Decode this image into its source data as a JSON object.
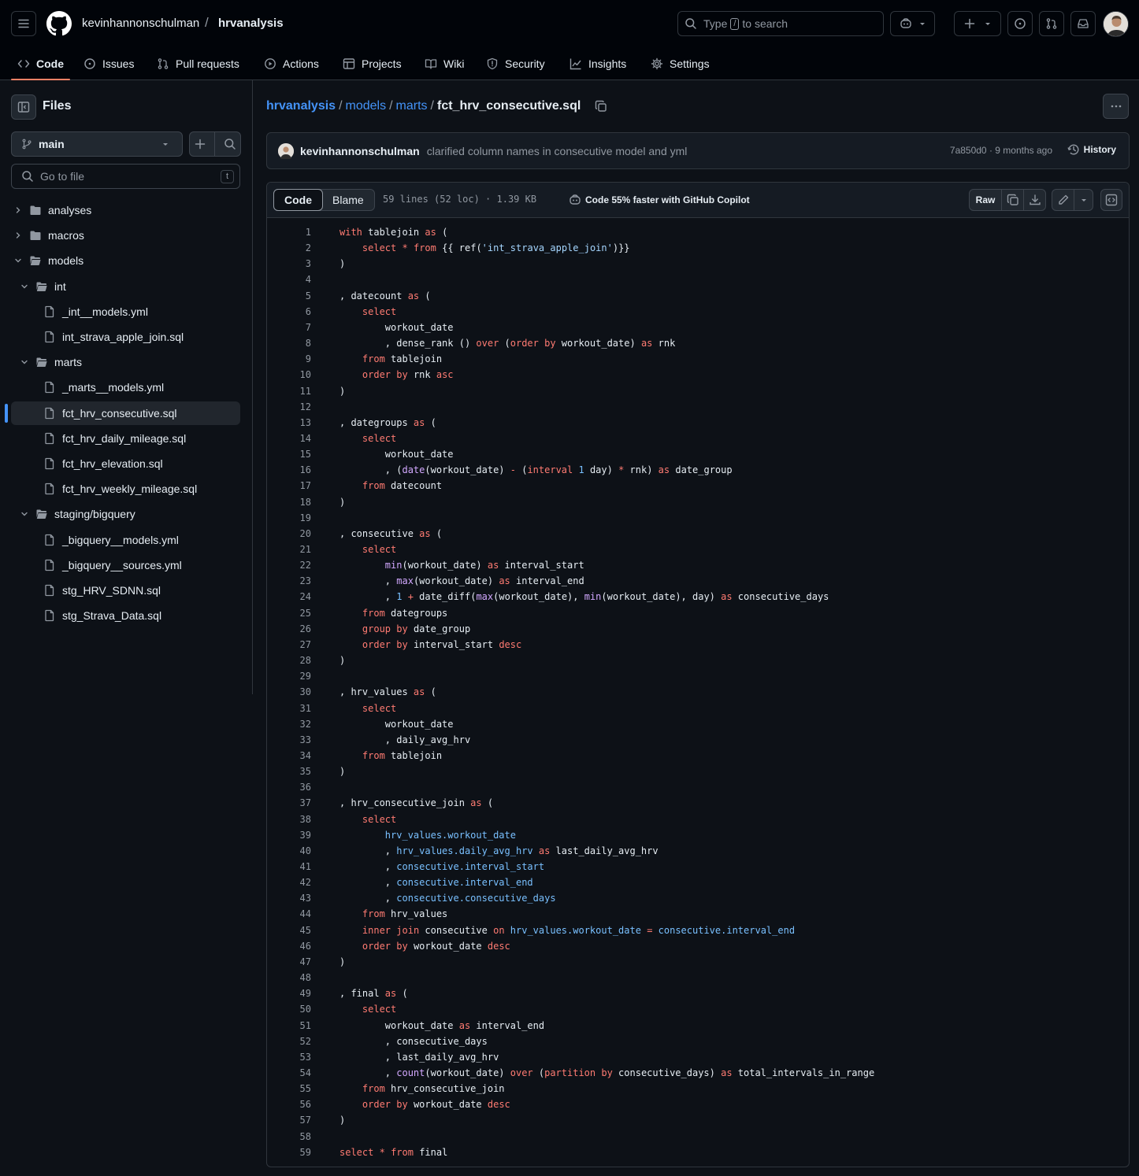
{
  "header": {
    "owner": "kevinhannonschulman",
    "separator": "/",
    "repo": "hrvanalysis",
    "search_pre": "Type",
    "search_key": "/",
    "search_post": "to search"
  },
  "repo_tabs": [
    {
      "label": "Code",
      "icon": "code-icon",
      "active": true
    },
    {
      "label": "Issues",
      "icon": "issue-icon"
    },
    {
      "label": "Pull requests",
      "icon": "pull-request-icon"
    },
    {
      "label": "Actions",
      "icon": "actions-play-icon"
    },
    {
      "label": "Projects",
      "icon": "table-icon"
    },
    {
      "label": "Wiki",
      "icon": "book-icon"
    },
    {
      "label": "Security",
      "icon": "shield-icon"
    },
    {
      "label": "Insights",
      "icon": "graph-icon"
    },
    {
      "label": "Settings",
      "icon": "gear-icon"
    }
  ],
  "sidebar": {
    "title": "Files",
    "branch": "main",
    "goto_placeholder": "Go to file",
    "goto_key": "t",
    "tree": [
      {
        "name": "analyses",
        "type": "folder",
        "depth": 0,
        "expanded": false
      },
      {
        "name": "macros",
        "type": "folder",
        "depth": 0,
        "expanded": false
      },
      {
        "name": "models",
        "type": "folder",
        "depth": 0,
        "expanded": true
      },
      {
        "name": "int",
        "type": "folder",
        "depth": 1,
        "expanded": true
      },
      {
        "name": "_int__models.yml",
        "type": "file",
        "depth": 2
      },
      {
        "name": "int_strava_apple_join.sql",
        "type": "file",
        "depth": 2
      },
      {
        "name": "marts",
        "type": "folder",
        "depth": 1,
        "expanded": true
      },
      {
        "name": "_marts__models.yml",
        "type": "file",
        "depth": 2
      },
      {
        "name": "fct_hrv_consecutive.sql",
        "type": "file",
        "depth": 2,
        "selected": true
      },
      {
        "name": "fct_hrv_daily_mileage.sql",
        "type": "file",
        "depth": 2
      },
      {
        "name": "fct_hrv_elevation.sql",
        "type": "file",
        "depth": 2
      },
      {
        "name": "fct_hrv_weekly_mileage.sql",
        "type": "file",
        "depth": 2
      },
      {
        "name": "staging/bigquery",
        "type": "folder",
        "depth": 1,
        "expanded": true
      },
      {
        "name": "_bigquery__models.yml",
        "type": "file",
        "depth": 2
      },
      {
        "name": "_bigquery__sources.yml",
        "type": "file",
        "depth": 2
      },
      {
        "name": "stg_HRV_SDNN.sql",
        "type": "file",
        "depth": 2
      },
      {
        "name": "stg_Strava_Data.sql",
        "type": "file",
        "depth": 2
      }
    ]
  },
  "breadcrumb": {
    "repo": "hrvanalysis",
    "path": [
      "models",
      "marts"
    ],
    "file": "fct_hrv_consecutive.sql"
  },
  "commit": {
    "author": "kevinhannonschulman",
    "message": "clarified column names in consecutive model and yml",
    "meta": "7a850d0 · 9 months ago",
    "history_label": "History"
  },
  "file_toolbar": {
    "code_tab": "Code",
    "blame_tab": "Blame",
    "file_meta": "59 lines (52 loc) · 1.39 KB",
    "copilot": "Code 55% faster with GitHub Copilot",
    "raw_label": "Raw"
  },
  "colors": {
    "accent": "#4493f8",
    "keyword": "#ff7b72",
    "function": "#d2a8ff",
    "string": "#a5d6ff",
    "tab_underline": "#f78166"
  },
  "code_lines": [
    "with tablejoin as (",
    "    select * from {{ ref('int_strava_apple_join')}}",
    ")",
    "",
    ", datecount as (",
    "    select",
    "        workout_date",
    "        , dense_rank () over (order by workout_date) as rnk",
    "    from tablejoin",
    "    order by rnk asc",
    ")",
    "",
    ", dategroups as (",
    "    select",
    "        workout_date",
    "        , (date(workout_date) - (interval 1 day) * rnk) as date_group",
    "    from datecount",
    ")",
    "",
    ", consecutive as (",
    "    select",
    "        min(workout_date) as interval_start",
    "        , max(workout_date) as interval_end",
    "        , 1 + date_diff(max(workout_date), min(workout_date), day) as consecutive_days",
    "    from dategroups",
    "    group by date_group",
    "    order by interval_start desc",
    ")",
    "",
    ", hrv_values as (",
    "    select",
    "        workout_date",
    "        , daily_avg_hrv",
    "    from tablejoin",
    ")",
    "",
    ", hrv_consecutive_join as (",
    "    select",
    "        hrv_values.workout_date",
    "        , hrv_values.daily_avg_hrv as last_daily_avg_hrv",
    "        , consecutive.interval_start",
    "        , consecutive.interval_end",
    "        , consecutive.consecutive_days",
    "    from hrv_values",
    "    inner join consecutive on hrv_values.workout_date = consecutive.interval_end",
    "    order by workout_date desc",
    ")",
    "",
    ", final as (",
    "    select",
    "        workout_date as interval_end",
    "        , consecutive_days",
    "        , last_daily_avg_hrv",
    "        , count(workout_date) over (partition by consecutive_days) as total_intervals_in_range",
    "    from hrv_consecutive_join",
    "    order by workout_date desc",
    ")",
    "",
    "select * from final"
  ]
}
